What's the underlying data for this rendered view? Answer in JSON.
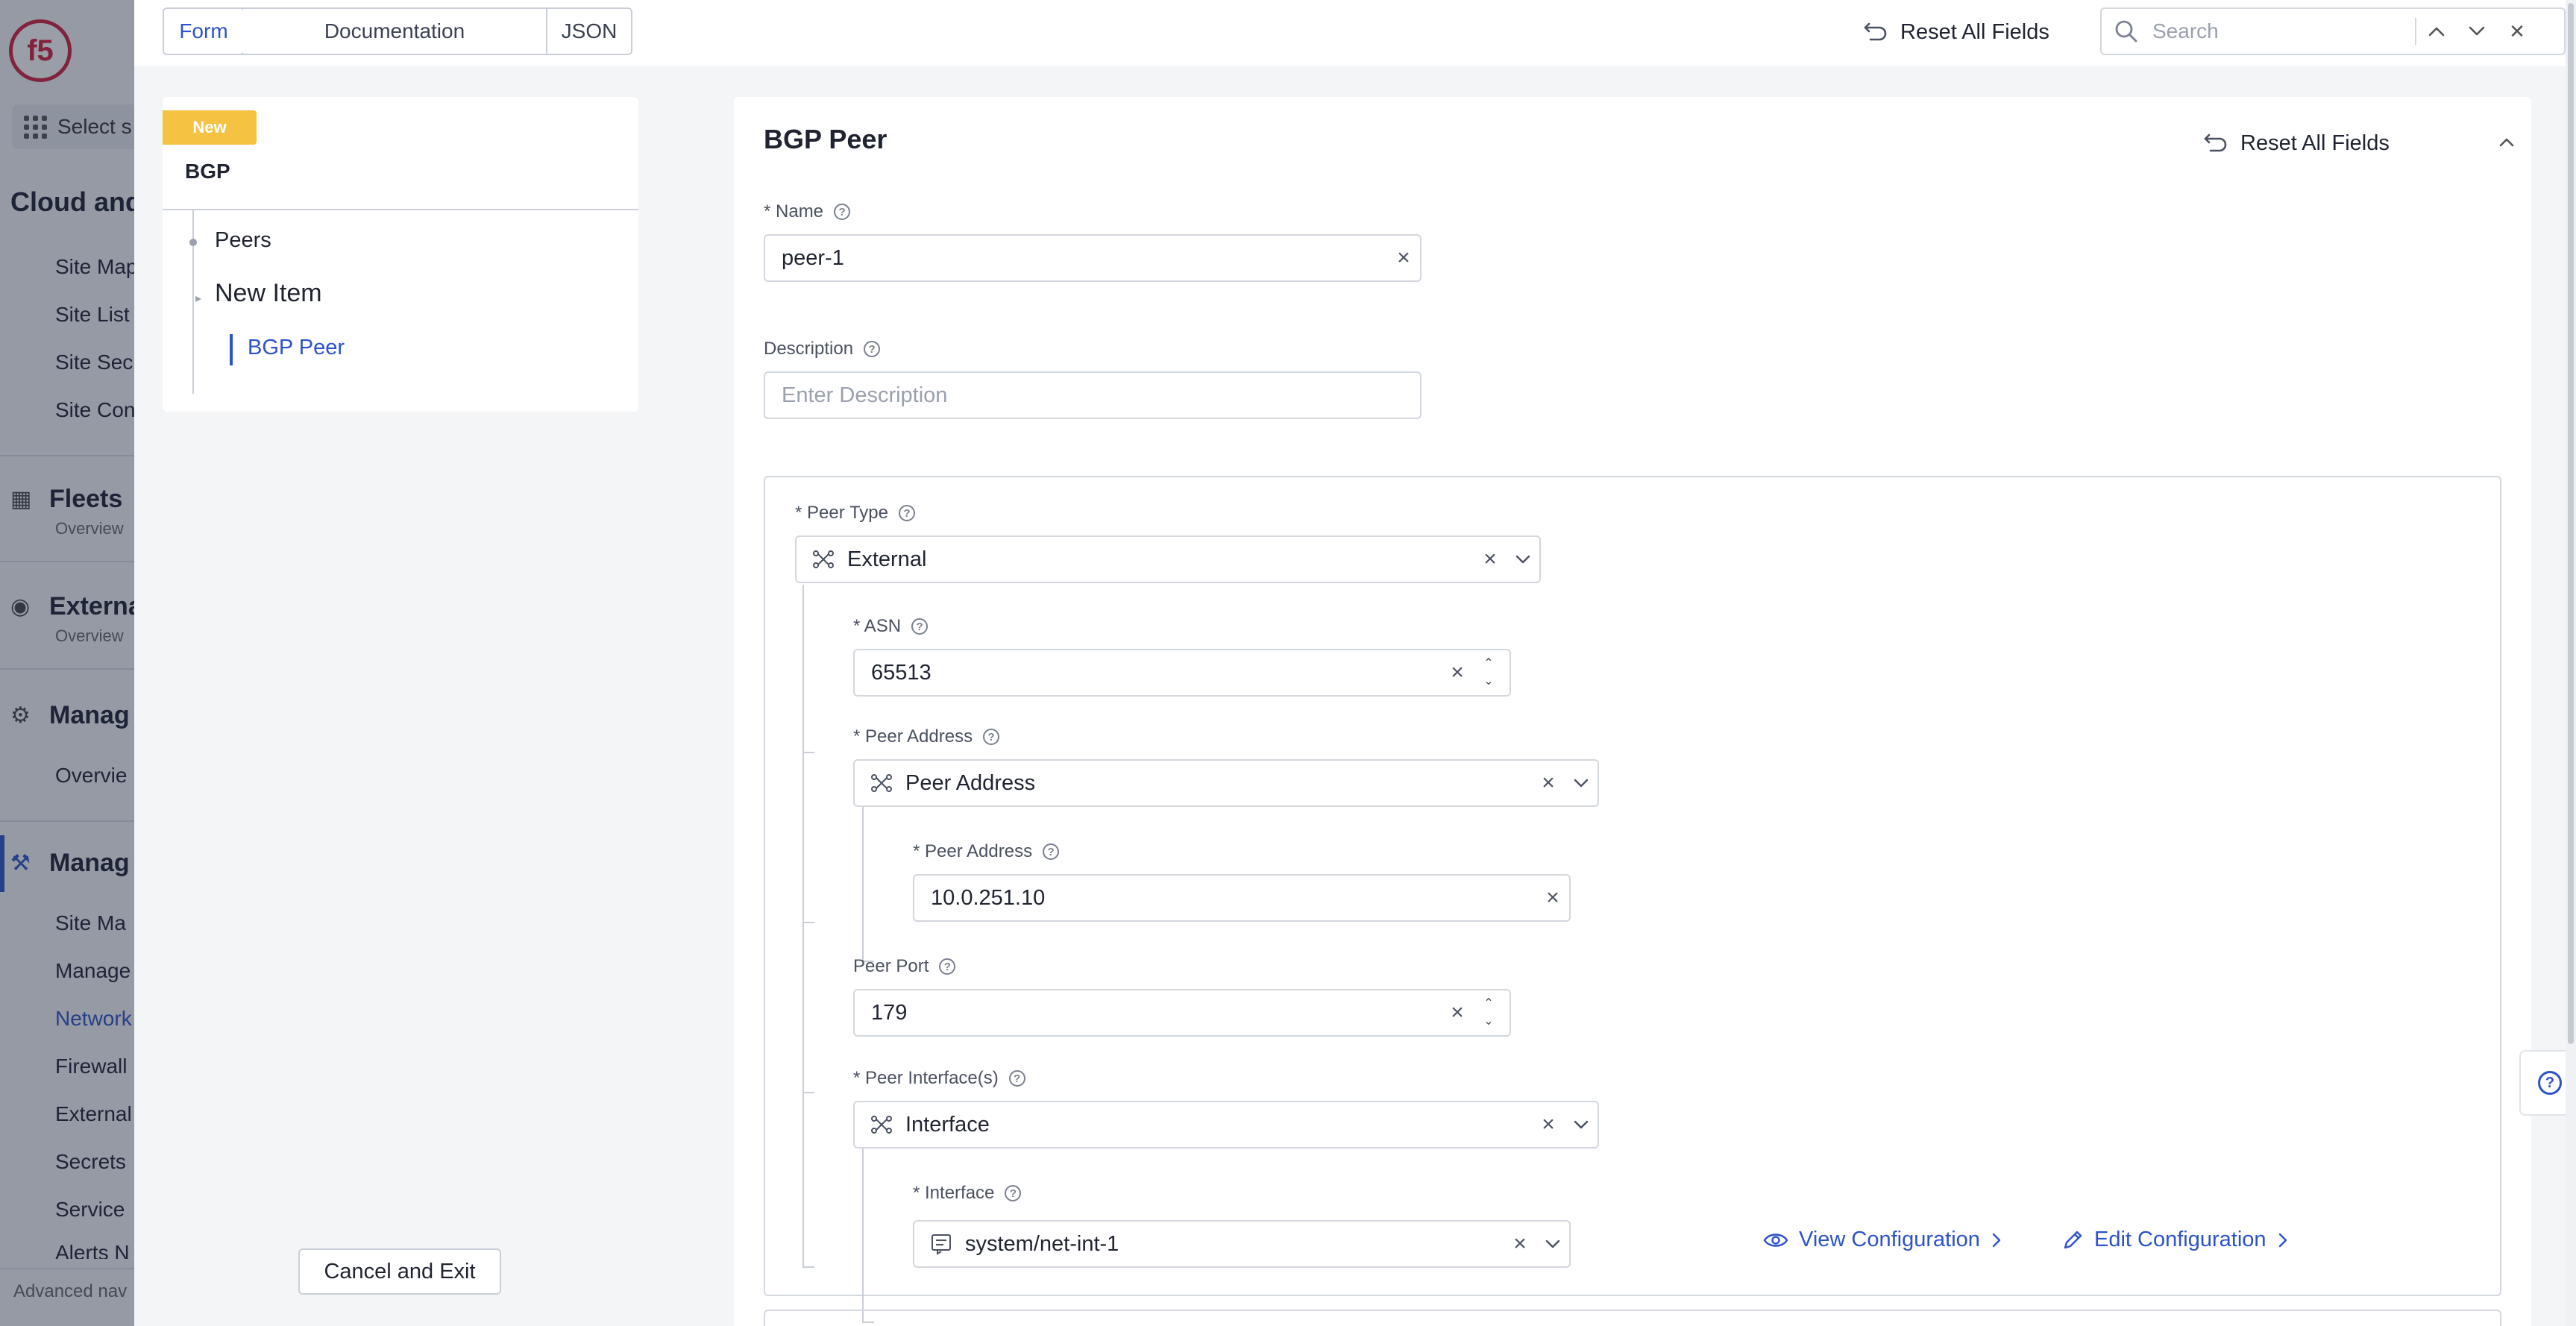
{
  "background_app": {
    "logo": "f5",
    "select_label": "Select s",
    "heading": "Cloud and",
    "site_items": [
      "Site Map",
      "Site List",
      "Site Sec",
      "Site Con"
    ],
    "sections": [
      {
        "label": "Fleets",
        "sub": "Overview"
      },
      {
        "label": "Externa",
        "sub": "Overview"
      },
      {
        "label": "Manag",
        "sub": ""
      }
    ],
    "overview_item": "Overvie",
    "active_section": "Manag",
    "manage_items": [
      "Site Ma",
      "Manage",
      "Network",
      "Firewall",
      "External",
      "Secrets",
      "Service",
      "Alerts N"
    ],
    "active_manage_item": "Network",
    "footer": "Advanced nav"
  },
  "topbar": {
    "tabs": [
      {
        "label": "Form",
        "active": true
      },
      {
        "label": "Documentation",
        "active": false
      },
      {
        "label": "JSON",
        "active": false
      }
    ],
    "reset_label": "Reset All Fields",
    "search_placeholder": "Search"
  },
  "nav": {
    "badge": "New",
    "title": "BGP",
    "items": {
      "peers": "Peers",
      "new_item": "New Item",
      "bgp_peer": "BGP Peer"
    },
    "cancel_label": "Cancel and Exit"
  },
  "form": {
    "title": "BGP Peer",
    "reset_label": "Reset All Fields",
    "name": {
      "label": "* Name",
      "value": "peer-1"
    },
    "description": {
      "label": "Description",
      "placeholder": "Enter Description",
      "value": ""
    },
    "peer_type": {
      "label": "* Peer Type",
      "value": "External"
    },
    "asn": {
      "label": "* ASN",
      "value": "65513"
    },
    "peer_address_choice": {
      "label": "* Peer Address",
      "value": "Peer Address"
    },
    "peer_address": {
      "label": "* Peer Address",
      "value": "10.0.251.10"
    },
    "peer_port": {
      "label": "Peer Port",
      "value": "179"
    },
    "peer_interfaces": {
      "label": "* Peer Interface(s)",
      "value": "Interface"
    },
    "interface": {
      "label": "* Interface",
      "value": "system/net-int-1"
    },
    "view_config_label": "View Configuration",
    "edit_config_label": "Edit Configuration"
  },
  "colors": {
    "accent": "#2c53c8",
    "badge": "#f5c242",
    "logo": "#d21f3c"
  }
}
